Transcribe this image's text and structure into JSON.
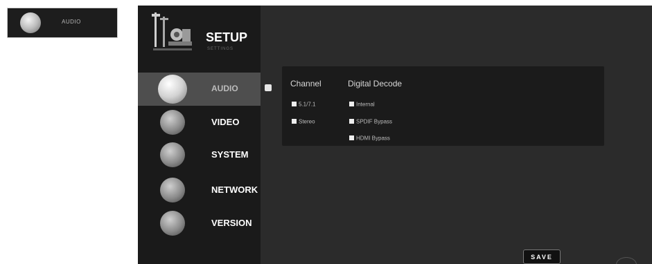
{
  "thumbnail": {
    "label": "AUDIO",
    "icon": "disc-icon"
  },
  "header": {
    "title": "SETUP",
    "subtitle": "SETTINGS",
    "icon": "tools-icon"
  },
  "menu": {
    "items": [
      {
        "label": "AUDIO",
        "icon": "audio-disc-icon",
        "active": true
      },
      {
        "label": "VIDEO",
        "icon": "video-disc-icon",
        "active": false
      },
      {
        "label": "SYSTEM",
        "icon": "system-disc-icon",
        "active": false
      },
      {
        "label": "NETWORK",
        "icon": "network-disc-icon",
        "active": false
      },
      {
        "label": "VERSION",
        "icon": "version-disc-icon",
        "active": false
      }
    ]
  },
  "audio_panel": {
    "channel": {
      "header": "Channel",
      "options": [
        "5.1/7.1",
        "Stereo"
      ]
    },
    "digital_decode": {
      "header": "Digital Decode",
      "options": [
        "Internal",
        "SPDIF Bypass",
        "HDMI Bypass"
      ]
    }
  },
  "save_button": {
    "label": "SAVE"
  },
  "colors": {
    "background": "#2b2b2b",
    "sidebar": "#1a1a1a",
    "active_item": "#4e4e4e",
    "panel": "#1b1b1b"
  }
}
